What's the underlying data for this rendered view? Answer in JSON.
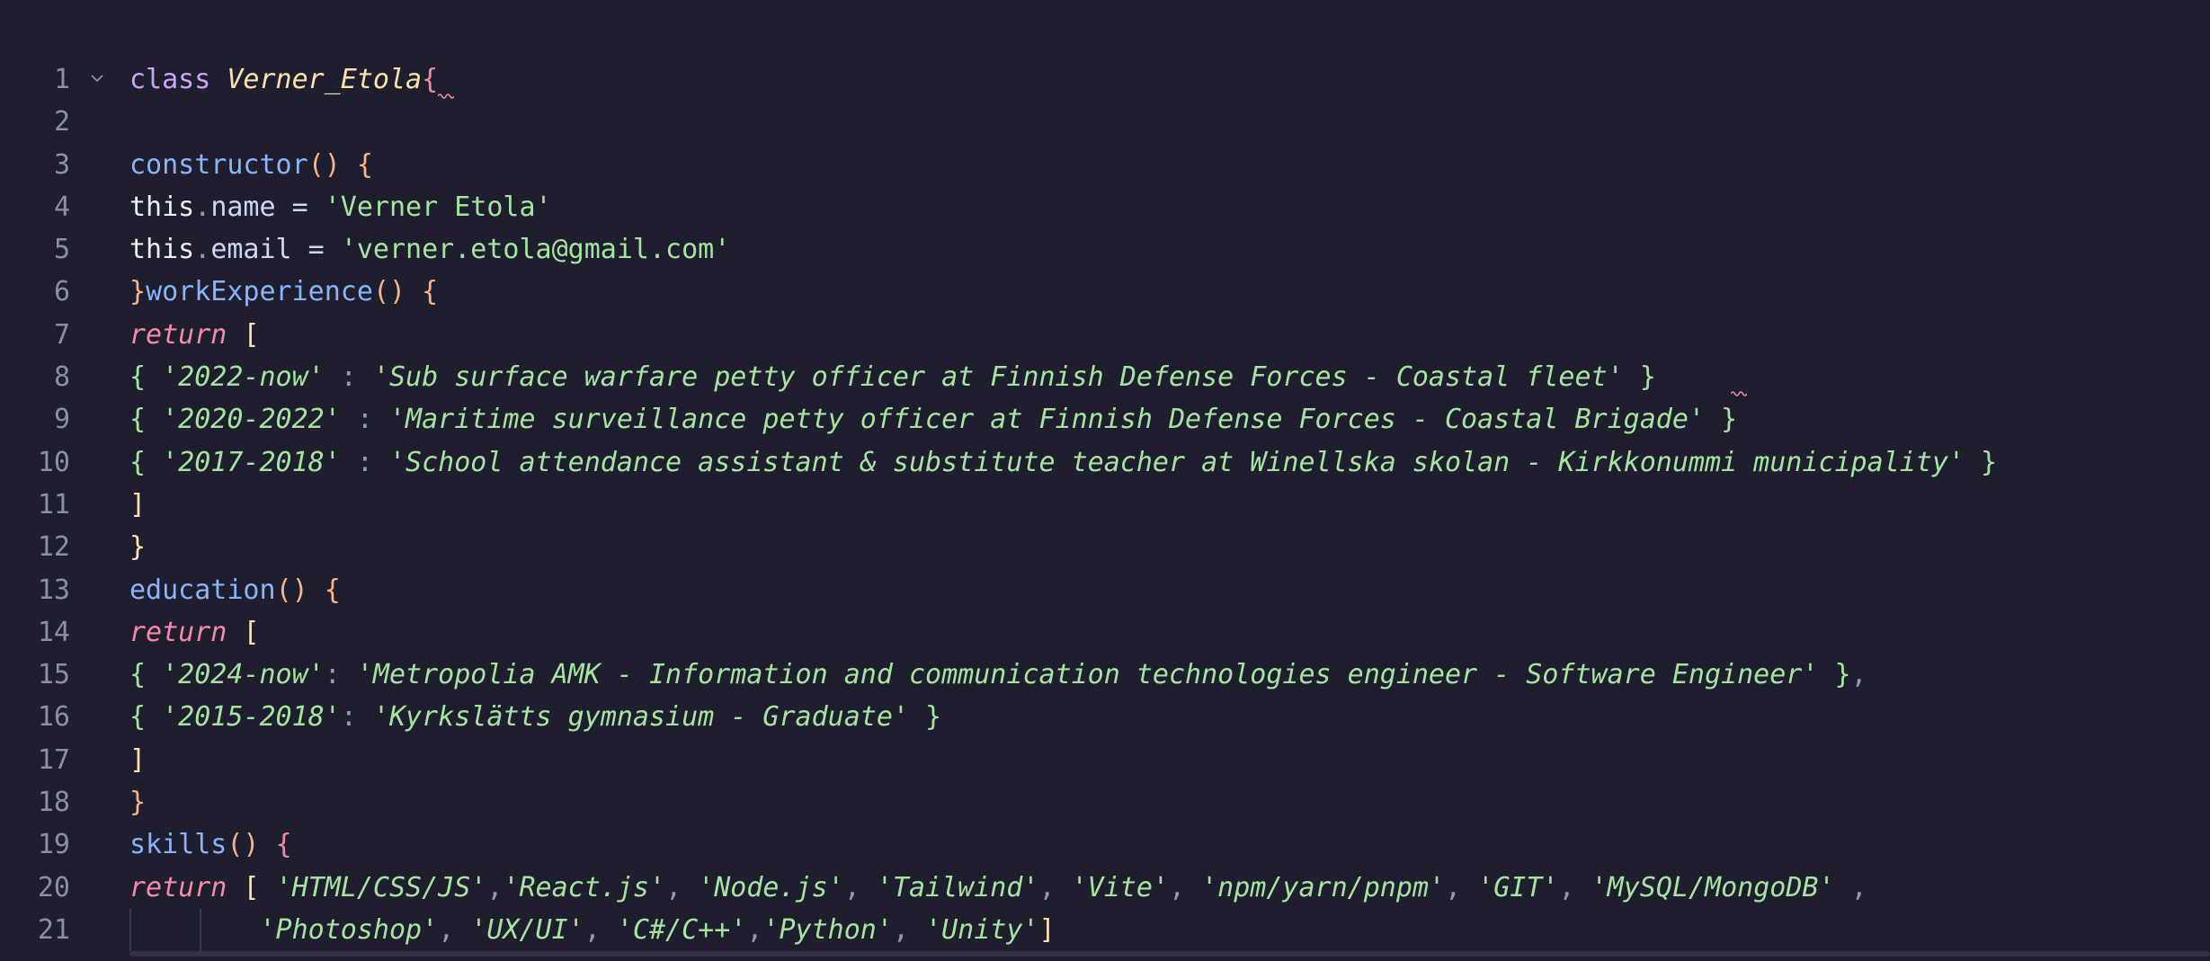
{
  "editor": {
    "lines": [
      {
        "n": "1",
        "segments": [
          [
            "kw",
            "class "
          ],
          [
            "cls",
            "Verner_Etola"
          ],
          [
            "brace",
            "{"
          ]
        ]
      },
      {
        "n": "2",
        "segments": []
      },
      {
        "n": "3",
        "segments": [
          [
            "fn",
            "constructor"
          ],
          [
            "paren",
            "() {"
          ]
        ]
      },
      {
        "n": "4",
        "segments": [
          [
            "this",
            "this"
          ],
          [
            "dot",
            "."
          ],
          [
            "prop",
            "name"
          ],
          [
            "op",
            " = "
          ],
          [
            "str",
            "'Verner Etola'"
          ]
        ]
      },
      {
        "n": "5",
        "segments": [
          [
            "this",
            "this"
          ],
          [
            "dot",
            "."
          ],
          [
            "prop",
            "email"
          ],
          [
            "op",
            " = "
          ],
          [
            "str",
            "'verner.etola@gmail.com'"
          ]
        ]
      },
      {
        "n": "6",
        "segments": [
          [
            "paren",
            "}"
          ],
          [
            "fn",
            "workExperience"
          ],
          [
            "paren",
            "() {"
          ]
        ]
      },
      {
        "n": "7",
        "segments": [
          [
            "ret",
            "return "
          ],
          [
            "br",
            "["
          ]
        ]
      },
      {
        "n": "8",
        "segments": [
          [
            "gbrace",
            "{ "
          ],
          [
            "stri",
            "'2022-now'"
          ],
          [
            "punc",
            " : "
          ],
          [
            "stri",
            "'Sub surface warfare petty officer at Finnish Defense Forces - Coastal fleet'"
          ],
          [
            "gbrace",
            " }"
          ]
        ]
      },
      {
        "n": "9",
        "segments": [
          [
            "gbrace",
            "{ "
          ],
          [
            "stri",
            "'2020-2022'"
          ],
          [
            "punc",
            " : "
          ],
          [
            "stri",
            "'Maritime surveillance petty officer at Finnish Defense Forces - Coastal Brigade'"
          ],
          [
            "gbrace",
            " }"
          ]
        ]
      },
      {
        "n": "10",
        "segments": [
          [
            "gbrace",
            "{ "
          ],
          [
            "stri",
            "'2017-2018'"
          ],
          [
            "punc",
            " : "
          ],
          [
            "stri",
            "'School attendance assistant & substitute teacher at Winellska skolan - Kirkkonummi municipality'"
          ],
          [
            "gbrace",
            " }"
          ]
        ]
      },
      {
        "n": "11",
        "segments": [
          [
            "br",
            "]"
          ]
        ]
      },
      {
        "n": "12",
        "segments": [
          [
            "br",
            "}"
          ]
        ]
      },
      {
        "n": "13",
        "segments": [
          [
            "fn",
            "education"
          ],
          [
            "paren",
            "() {"
          ]
        ]
      },
      {
        "n": "14",
        "segments": [
          [
            "ret",
            "return "
          ],
          [
            "br",
            "["
          ]
        ]
      },
      {
        "n": "15",
        "segments": [
          [
            "gbrace",
            "{ "
          ],
          [
            "stri",
            "'2024-now'"
          ],
          [
            "punc",
            ": "
          ],
          [
            "stri",
            "'Metropolia AMK - Information and communication technologies engineer - Software Engineer'"
          ],
          [
            "gbrace",
            " }"
          ],
          [
            "punc",
            ","
          ]
        ]
      },
      {
        "n": "16",
        "segments": [
          [
            "gbrace",
            "{ "
          ],
          [
            "stri",
            "'2015-2018'"
          ],
          [
            "punc",
            ": "
          ],
          [
            "stri",
            "'Kyrkslätts gymnasium - Graduate'"
          ],
          [
            "gbrace",
            " }"
          ]
        ]
      },
      {
        "n": "17",
        "segments": [
          [
            "br",
            "]"
          ]
        ]
      },
      {
        "n": "18",
        "segments": [
          [
            "paren",
            "}"
          ]
        ]
      },
      {
        "n": "19",
        "segments": [
          [
            "fn",
            "skills"
          ],
          [
            "paren",
            "() "
          ],
          [
            "brace",
            "{"
          ]
        ]
      },
      {
        "n": "20",
        "segments": [
          [
            "ret",
            "return "
          ],
          [
            "br",
            "[ "
          ],
          [
            "stri",
            "'HTML/CSS/JS'"
          ],
          [
            "punc",
            ","
          ],
          [
            "stri",
            "'React.js'"
          ],
          [
            "punc",
            ", "
          ],
          [
            "stri",
            "'Node.js'"
          ],
          [
            "punc",
            ", "
          ],
          [
            "stri",
            "'Tailwind'"
          ],
          [
            "punc",
            ", "
          ],
          [
            "stri",
            "'Vite'"
          ],
          [
            "punc",
            ", "
          ],
          [
            "stri",
            "'npm/yarn/pnpm'"
          ],
          [
            "punc",
            ", "
          ],
          [
            "stri",
            "'GIT'"
          ],
          [
            "punc",
            ", "
          ],
          [
            "stri",
            "'MySQL/MongoDB'"
          ],
          [
            "punc",
            " ,"
          ]
        ]
      },
      {
        "n": "21",
        "segments": [
          [
            "punc",
            "        "
          ],
          [
            "stri",
            "'Photoshop'"
          ],
          [
            "punc",
            ", "
          ],
          [
            "stri",
            "'UX/UI'"
          ],
          [
            "punc",
            ", "
          ],
          [
            "stri",
            "'C#/C++'"
          ],
          [
            "punc",
            ","
          ],
          [
            "stri",
            "'Python'"
          ],
          [
            "punc",
            ", "
          ],
          [
            "stri",
            "'Unity'"
          ],
          [
            "br",
            "]"
          ]
        ]
      }
    ]
  }
}
